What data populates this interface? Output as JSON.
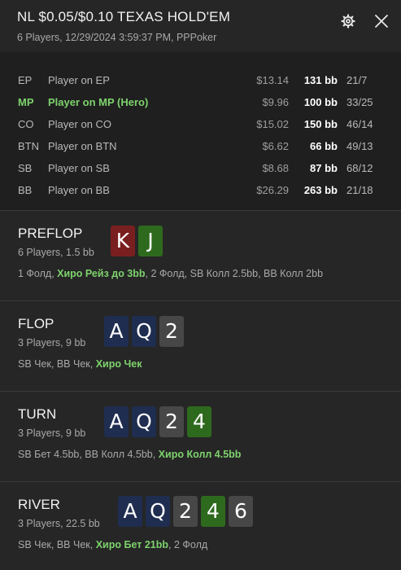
{
  "header": {
    "title": "NL $0.05/$0.10 TEXAS HOLD'EM",
    "subtitle": "6 Players, 12/29/2024 3:59:37 PM, PPPoker",
    "settings_icon": "gear-icon",
    "close_icon": "close-icon"
  },
  "players": [
    {
      "pos": "EP",
      "name": "Player on EP",
      "money": "$13.14",
      "bb": "131 bb",
      "stat": "21/7",
      "hero": false
    },
    {
      "pos": "MP",
      "name": "Player on MP (Hero)",
      "money": "$9.96",
      "bb": "100 bb",
      "stat": "33/25",
      "hero": true
    },
    {
      "pos": "CO",
      "name": "Player on CO",
      "money": "$15.02",
      "bb": "150 bb",
      "stat": "46/14",
      "hero": false
    },
    {
      "pos": "BTN",
      "name": "Player on BTN",
      "money": "$6.62",
      "bb": "66 bb",
      "stat": "49/13",
      "hero": false
    },
    {
      "pos": "SB",
      "name": "Player on SB",
      "money": "$8.68",
      "bb": "87 bb",
      "stat": "68/12",
      "hero": false
    },
    {
      "pos": "BB",
      "name": "Player on BB",
      "money": "$26.29",
      "bb": "263 bb",
      "stat": "21/18",
      "hero": false
    }
  ],
  "streets": {
    "preflop": {
      "title": "PREFLOP",
      "sub": "6 Players, 1.5 bb",
      "cards": [
        {
          "rank": "K",
          "color": "red"
        },
        {
          "rank": "J",
          "color": "green"
        }
      ],
      "actions": {
        "a1": "1 Фолд, ",
        "hero": "Хиро Рейз до 3bb",
        "a2": ", 2 Фолд, SB Колл 2.5bb, BB Колл 2bb"
      }
    },
    "flop": {
      "title": "FLOP",
      "sub": "3 Players, 9 bb",
      "cards": [
        {
          "rank": "A",
          "color": "blue"
        },
        {
          "rank": "Q",
          "color": "blue"
        },
        {
          "rank": "2",
          "color": "gray"
        }
      ],
      "actions": {
        "a1": "SB Чек, BB Чек, ",
        "hero": "Хиро Чек",
        "a2": ""
      }
    },
    "turn": {
      "title": "TURN",
      "sub": "3 Players, 9 bb",
      "cards": [
        {
          "rank": "A",
          "color": "blue"
        },
        {
          "rank": "Q",
          "color": "blue"
        },
        {
          "rank": "2",
          "color": "gray"
        },
        {
          "rank": "4",
          "color": "green"
        }
      ],
      "actions": {
        "a1": "SB Бет 4.5bb, BB Колл 4.5bb, ",
        "hero": "Хиро Колл 4.5bb",
        "a2": ""
      }
    },
    "river": {
      "title": "RIVER",
      "sub": "3 Players, 22.5 bb",
      "cards": [
        {
          "rank": "A",
          "color": "blue"
        },
        {
          "rank": "Q",
          "color": "blue"
        },
        {
          "rank": "2",
          "color": "gray"
        },
        {
          "rank": "4",
          "color": "green"
        },
        {
          "rank": "6",
          "color": "gray"
        }
      ],
      "actions": {
        "a1": "SB Чек, BB Чек, ",
        "hero": "Хиро Бет 21bb",
        "a2": ", 2 Фолд"
      }
    }
  },
  "colors": {
    "hero_green": "#7ed36d",
    "card_red": "#7a1f1f",
    "card_green": "#2e6a1e",
    "card_blue": "#1f2d50",
    "card_gray": "#474747"
  }
}
